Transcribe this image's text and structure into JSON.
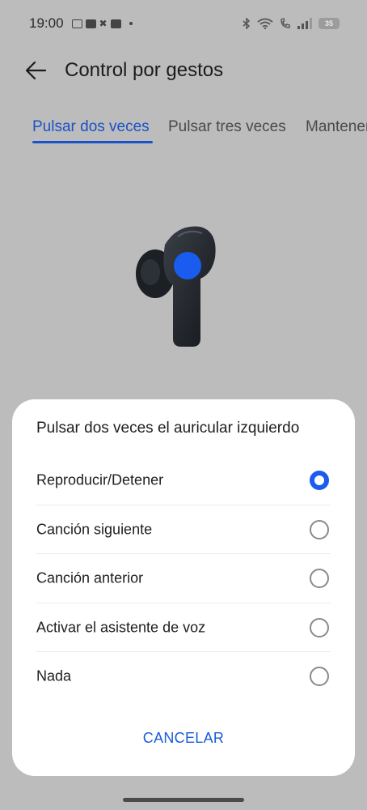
{
  "status_bar": {
    "time": "19:00",
    "battery_level": "35",
    "icons": [
      "calendar-notification-icon",
      "youtube-icon",
      "capcut-icon",
      "youtube-icon",
      "more-notifications-dot",
      "bluetooth-icon",
      "wifi-icon",
      "wifi-calling-icon",
      "signal-icon",
      "battery-icon"
    ]
  },
  "header": {
    "title": "Control por gestos",
    "back_icon": "arrow-left-icon"
  },
  "tabs": [
    {
      "label": "Pulsar dos veces",
      "active": true
    },
    {
      "label": "Pulsar tres veces",
      "active": false
    },
    {
      "label": "Mantener",
      "active": false
    }
  ],
  "illustration": {
    "icon": "earbud-icon",
    "accent_color": "#1a5cf0"
  },
  "dialog": {
    "title": "Pulsar dos veces el auricular izquierdo",
    "options": [
      {
        "label": "Reproducir/Detener",
        "selected": true
      },
      {
        "label": "Canción siguiente",
        "selected": false
      },
      {
        "label": "Canción anterior",
        "selected": false
      },
      {
        "label": "Activar el asistente de voz",
        "selected": false
      },
      {
        "label": "Nada",
        "selected": false
      }
    ],
    "cancel_label": "CANCELAR"
  },
  "colors": {
    "accent": "#1a5cf0",
    "scrim_background": "#bcbcbc",
    "sheet_background": "#ffffff"
  }
}
